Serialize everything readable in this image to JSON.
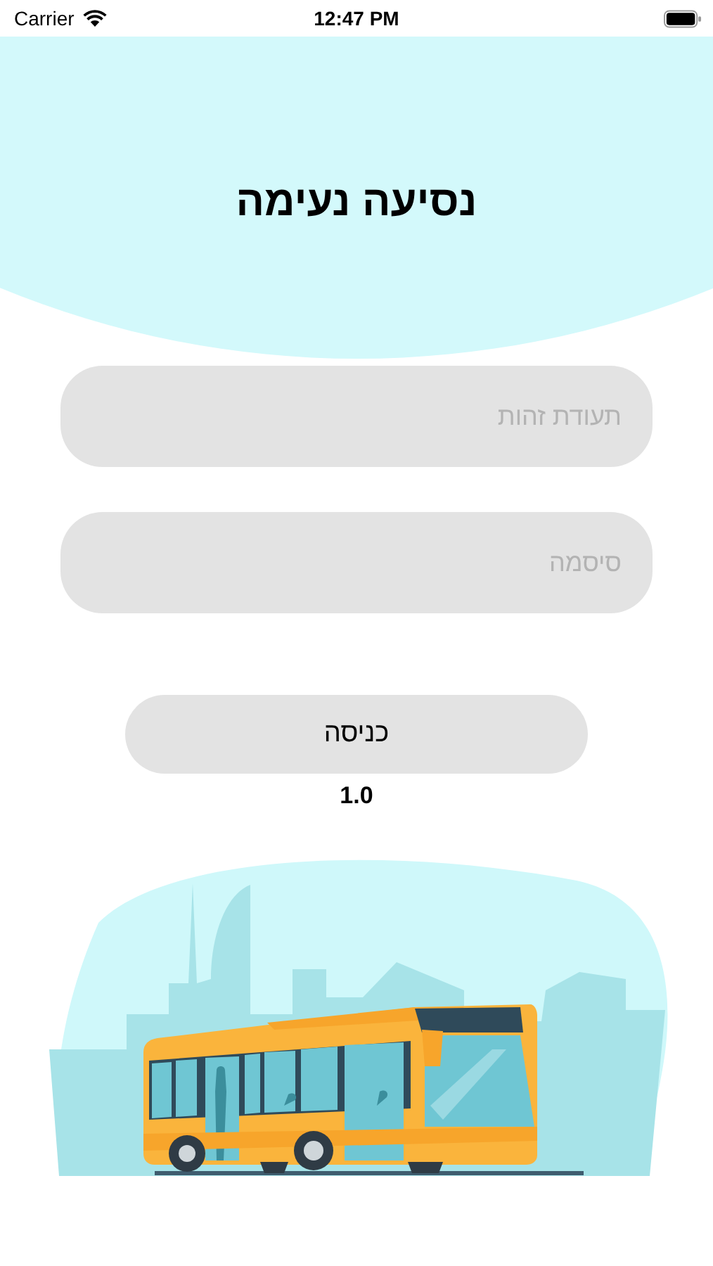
{
  "status_bar": {
    "carrier": "Carrier",
    "time": "12:47 PM"
  },
  "title": "נסיעה נעימה",
  "fields": [
    {
      "placeholder": "תעודת זהות"
    },
    {
      "placeholder": "סיסמה"
    }
  ],
  "login_button": {
    "label": "כניסה"
  },
  "version": "1.0"
}
